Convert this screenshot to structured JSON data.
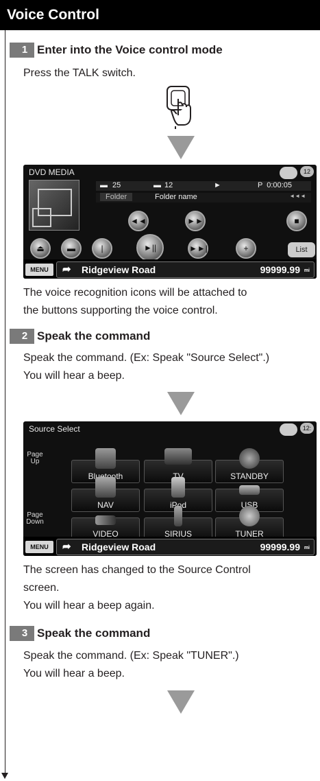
{
  "header": {
    "title": "Voice Control"
  },
  "steps": [
    {
      "num": "1",
      "title": "Enter into the Voice control mode"
    },
    {
      "num": "2",
      "title": "Speak the command"
    },
    {
      "num": "3",
      "title": "Speak the command"
    }
  ],
  "text": {
    "press_talk": "Press the TALK switch.",
    "icons_attached_1": "The voice recognition icons will be attached to",
    "icons_attached_2": "the buttons supporting the voice control.",
    "speak_example_1": "Speak the command. (Ex: Speak \"Source Select\".)",
    "hear_beep_1": "You will hear a beep.",
    "changed_1": "The screen has changed to the Source Control",
    "changed_2": "screen.",
    "hear_beep_again": "You will hear a beep again.",
    "speak_example_2": "Speak the command. (Ex: Speak \"TUNER\".)",
    "hear_beep_2": "You will hear a beep."
  },
  "dvd_screen": {
    "title": "DVD MEDIA",
    "clock": "12",
    "folder_count": "25",
    "file_count": "12",
    "play_symbol": "►",
    "time": "P  0:00:05",
    "folder_label": "Folder",
    "folder_name": "Folder name",
    "list_label": "List"
  },
  "source_screen": {
    "title": "Source Select",
    "clock": "12:",
    "page_up": "Page Up",
    "page_down": "Page Down",
    "sources": [
      "Bluetooth",
      "TV",
      "STANDBY",
      "NAV",
      "iPod",
      "USB",
      "VIDEO",
      "SIRIUS",
      "TUNER"
    ]
  },
  "navbar": {
    "menu_label": "MENU",
    "road": "Ridgeview Road",
    "distance": "99999.99",
    "unit": "mi"
  },
  "colors": {
    "header_bg": "#000000",
    "step_bg": "#7a7a7a",
    "arrow": "#9a9a9a"
  }
}
